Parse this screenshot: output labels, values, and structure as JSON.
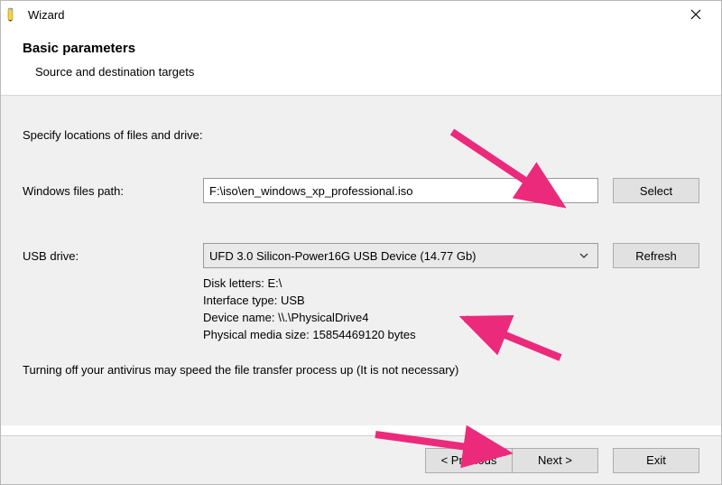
{
  "window": {
    "title": "Wizard"
  },
  "header": {
    "heading": "Basic parameters",
    "subtitle": "Source and destination targets"
  },
  "main": {
    "instruction": "Specify locations of files and drive:",
    "path_label": "Windows files path:",
    "path_value": "F:\\iso\\en_windows_xp_professional.iso",
    "select_button": "Select",
    "usb_label": "USB drive:",
    "usb_selected": "UFD 3.0 Silicon-Power16G USB Device (14.77 Gb)",
    "refresh_button": "Refresh",
    "details": {
      "disk_letters_label": "Disk letters: ",
      "disk_letters_value": "E:\\",
      "interface_label": "Interface type: ",
      "interface_value": "USB",
      "device_name_label": "Device name: ",
      "device_name_value": "\\\\.\\PhysicalDrive4",
      "media_size_label": "Physical media size: ",
      "media_size_value": "15854469120 bytes"
    },
    "hint": "Turning off your antivirus may speed the file transfer process up (It is not necessary)"
  },
  "footer": {
    "previous": "< Previous",
    "next": "Next >",
    "exit": "Exit"
  }
}
